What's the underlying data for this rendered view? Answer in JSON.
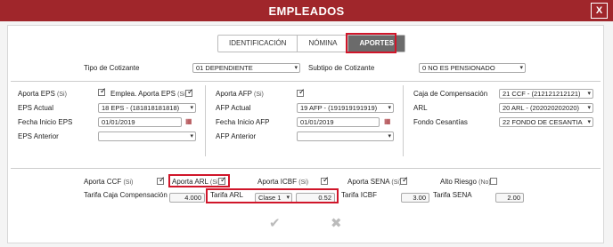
{
  "window": {
    "title": "EMPLEADOS",
    "close_label": "X"
  },
  "tabs": [
    {
      "label": "IDENTIFICACIÓN"
    },
    {
      "label": "NÓMINA"
    },
    {
      "label": "APORTES"
    }
  ],
  "cotizante": {
    "tipo_label": "Tipo de Cotizante",
    "tipo_value": "01 DEPENDIENTE",
    "subtipo_label": "Subtipo de Cotizante",
    "subtipo_value": "0 NO ES PENSIONADO"
  },
  "eps": {
    "aporta_label": "Aporta EPS",
    "aporta_hint": "(Si)",
    "emplea_label": "Emplea. Aporta EPS",
    "emplea_hint": "(Si)",
    "actual_label": "EPS Actual",
    "actual_value": "18 EPS - (181818181818)",
    "fecha_label": "Fecha Inicio EPS",
    "fecha_value": "01/01/2019",
    "anterior_label": "EPS Anterior",
    "anterior_value": ""
  },
  "afp": {
    "aporta_label": "Aporta AFP",
    "aporta_hint": "(Si)",
    "actual_label": "AFP Actual",
    "actual_value": "19 AFP - (191919191919)",
    "fecha_label": "Fecha Inicio AFP",
    "fecha_value": "01/01/2019",
    "anterior_label": "AFP Anterior",
    "anterior_value": ""
  },
  "caja": {
    "caja_label": "Caja de Compensación",
    "caja_value": "21 CCF - (212121212121)",
    "arl_label": "ARL",
    "arl_value": "20 ARL - (202020202020)",
    "cesantias_label": "Fondo Cesantías",
    "cesantias_value": "22 FONDO DE CESANTIA"
  },
  "aportes": {
    "ccf_label": "Aporta CCF",
    "ccf_hint": "(Si)",
    "arl_label": "Aporta ARL",
    "arl_hint": "(Si)",
    "icbf_label": "Aporta ICBF",
    "icbf_hint": "(Si)",
    "sena_label": "Aporta SENA",
    "sena_hint": "(Si)",
    "riesgo_label": "Alto Riesgo",
    "riesgo_hint": "(No)"
  },
  "tarifas": {
    "caja_label": "Tarifa Caja Compensación",
    "caja_value": "4.000",
    "arl_label": "Tarifa ARL",
    "arl_clase": "Clase 1",
    "arl_value": "0.52",
    "icbf_label": "Tarifa ICBF",
    "icbf_value": "3.00",
    "sena_label": "Tarifa SENA",
    "sena_value": "2.00"
  },
  "actions": {
    "save_icon": "checkmark-icon",
    "cancel_icon": "x-icon"
  },
  "colors": {
    "header": "#a0262b",
    "highlight": "#d0162a",
    "active_tab": "#6b6b6b"
  }
}
